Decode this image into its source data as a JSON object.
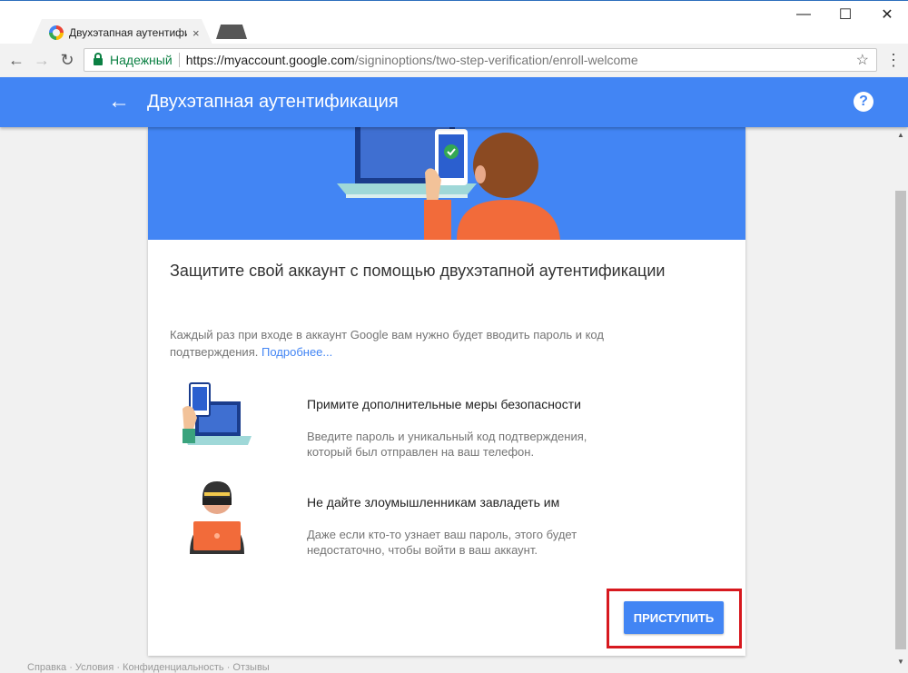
{
  "browser": {
    "tab_title": "Двухэтапная аутентифика",
    "tab_close": "×",
    "window": {
      "minimize": "—",
      "maximize": "☐",
      "close": "✕"
    },
    "nav": {
      "back": "←",
      "forward": "→",
      "reload": "↻"
    },
    "secure_label": "Надежный",
    "url_host": "https://myaccount.google.com",
    "url_path": "/signinoptions/two-step-verification/enroll-welcome",
    "star": "☆",
    "menu": "⋮"
  },
  "app": {
    "back": "←",
    "title": "Двухэтапная аутентификация",
    "help": "?"
  },
  "card": {
    "heading": "Защитите свой аккаунт с помощью двухэтапной аутентификации",
    "description": "Каждый раз при входе в аккаунт Google вам нужно будет вводить пароль и код подтверждения.",
    "learn_more": "Подробнее...",
    "features": [
      {
        "title": "Примите дополнительные меры безопасности",
        "text": "Введите пароль и уникальный код подтверждения, который был отправлен на ваш телефон."
      },
      {
        "title": "Не дайте злоумышленникам завладеть им",
        "text": "Даже если кто-то узнает ваш пароль, этого будет недостаточно, чтобы войти в ваш аккаунт."
      }
    ],
    "start_button": "ПРИСТУПИТЬ"
  },
  "scrollbar": {
    "up": "▲",
    "down": "▼"
  },
  "footer_text": "Справка · Условия · Конфиденциальность · Отзывы",
  "colors": {
    "accent": "#4285f4",
    "highlight": "#d7191f",
    "secure": "#0b8043"
  },
  "icons": [
    "google-favicon-icon",
    "lock-icon",
    "star-icon",
    "help-icon",
    "back-arrow-icon"
  ]
}
